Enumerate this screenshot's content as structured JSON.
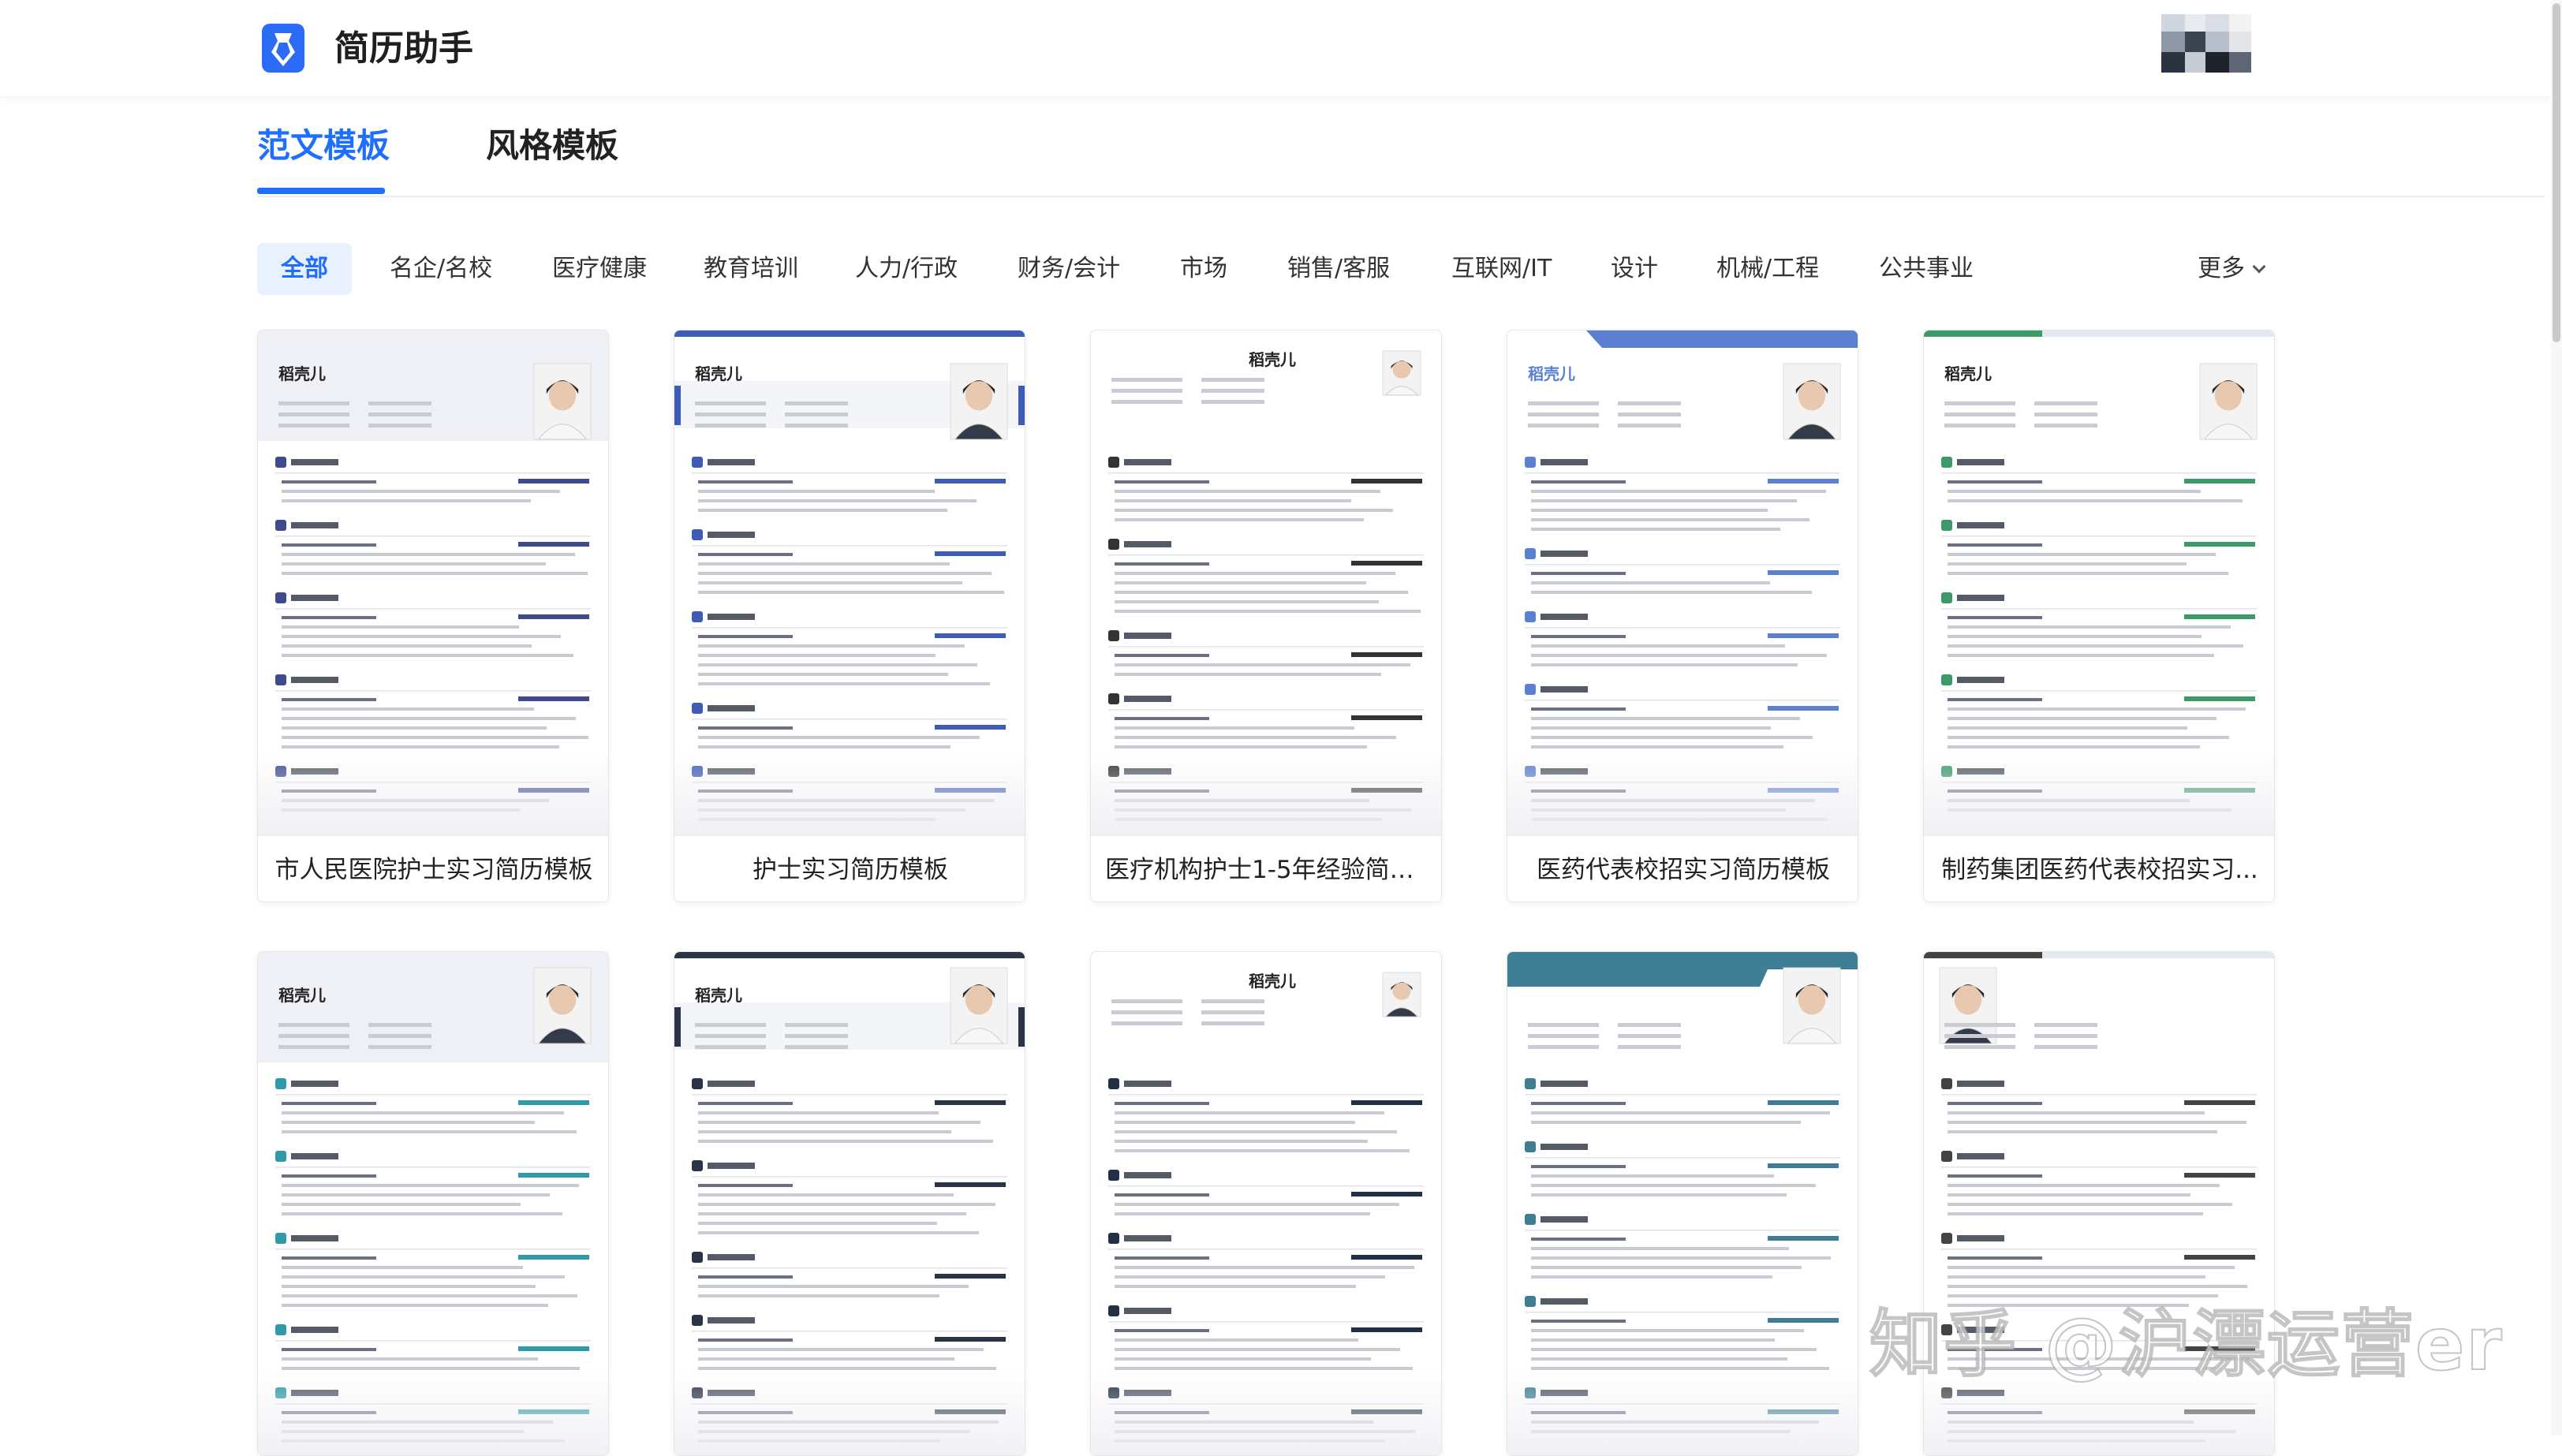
{
  "app": {
    "title": "简历助手",
    "brand_color": "#1f6fff"
  },
  "main_tabs": [
    {
      "label": "范文模板",
      "active": true
    },
    {
      "label": "风格模板",
      "active": false
    }
  ],
  "categories": [
    {
      "label": "全部",
      "active": true
    },
    {
      "label": "名企/名校"
    },
    {
      "label": "医疗健康"
    },
    {
      "label": "教育培训"
    },
    {
      "label": "人力/行政"
    },
    {
      "label": "财务/会计"
    },
    {
      "label": "市场"
    },
    {
      "label": "销售/客服"
    },
    {
      "label": "互联网/IT"
    },
    {
      "label": "设计"
    },
    {
      "label": "机械/工程"
    },
    {
      "label": "公共事业"
    }
  ],
  "more_label": "更多",
  "resume_sample_name": "稻壳儿",
  "templates": [
    {
      "title": "市人民医院护士实习简历模板",
      "accent": "#3f4b8c"
    },
    {
      "title": "护士实习简历模板",
      "accent": "#3e5bb8"
    },
    {
      "title": "医疗机构护士1-5年经验简历...",
      "accent": "#333333"
    },
    {
      "title": "医药代表校招实习简历模板",
      "accent": "#5b7fd1"
    },
    {
      "title": "制药集团医药代表校招实习...",
      "accent": "#3a9a68"
    },
    {
      "title": "",
      "accent": "#2f9aa8"
    },
    {
      "title": "",
      "accent": "#2b3447"
    },
    {
      "title": "",
      "accent": "#223046"
    },
    {
      "title": "",
      "accent": "#3e7f96"
    },
    {
      "title": "",
      "accent": "#444444"
    }
  ],
  "watermark": "知乎 @沪漂运营er"
}
